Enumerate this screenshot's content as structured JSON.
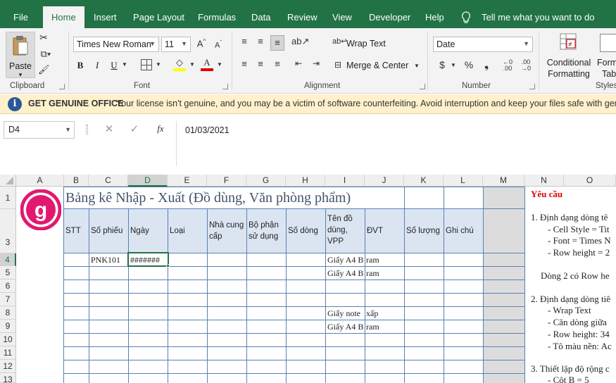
{
  "menu": {
    "tabs": [
      "File",
      "Home",
      "Insert",
      "Page Layout",
      "Formulas",
      "Data",
      "Review",
      "View",
      "Developer",
      "Help"
    ],
    "tell_me": "Tell me what you want to do"
  },
  "ribbon": {
    "paste_label": "Paste",
    "clipboard_label": "Clipboard",
    "font_name": "Times New Roman",
    "font_size": "11",
    "font_label": "Font",
    "bold": "B",
    "italic": "I",
    "underline": "U",
    "wrap_text": "Wrap Text",
    "merge_center": "Merge & Center",
    "alignment_label": "Alignment",
    "number_format": "Date",
    "number_label": "Number",
    "conditional_formatting_1": "Conditional",
    "conditional_formatting_2": "Formatting",
    "format_table_1": "Forma",
    "format_table_2": "Tab",
    "styles_label": "Styles",
    "font_color": "#e00000",
    "highlight_color": "#ffff00"
  },
  "banner": {
    "title": "GET GENUINE OFFICE",
    "message": "Your license isn't genuine, and you may be a victim of software counterfeiting. Avoid interruption and keep your files safe with genuine"
  },
  "formula_bar": {
    "name_box": "D4",
    "content": "01/03/2021"
  },
  "grid": {
    "columns": [
      "A",
      "B",
      "C",
      "D",
      "E",
      "F",
      "G",
      "H",
      "I",
      "J",
      "K",
      "L",
      "M",
      "N",
      "O"
    ],
    "rows": [
      "1",
      "3",
      "4",
      "5",
      "6",
      "7",
      "8",
      "9",
      "10",
      "11",
      "12",
      "13"
    ],
    "title": "Bảng kê Nhập - Xuất (Đồ dùng, Văn phòng phẩm)",
    "headers": {
      "stt": "STT",
      "so_phieu": "Số phiếu",
      "ngay": "Ngày",
      "loai": "Loại",
      "nha_cung_cap": "Nhà cung cấp",
      "bo_phan": "Bộ phận sử dụng",
      "so_dong": "Số dòng",
      "ten_do_dung": "Tên đồ dùng, VPP",
      "dvt": "ĐVT",
      "so_luong": "Số lượng",
      "ghi_chu": "Ghi chú"
    },
    "data": {
      "r4_c": "PNK101",
      "r4_d": "#######",
      "r4_i": "Giấy A4 B",
      "r4_j": "ram",
      "r5_i": "Giấy A4 B",
      "r5_j": "ram",
      "r8_i": "Giấy note",
      "r8_j": "xấp",
      "r9_i": "Giấy A4 B",
      "r9_j": "ram"
    },
    "logo_letter": "g",
    "logo_color": "#e2186f"
  },
  "notes": {
    "heading": "Yêu cầu",
    "l1": "1. Định dạng dòng tê",
    "l2": "- Cell Style = Tit",
    "l3": "- Font = Times N",
    "l4": "- Row height = 2",
    "l5": "Dòng 2 có Row he",
    "l6": "2. Định dạng dòng tiê",
    "l7": "- Wrap Text",
    "l8": "- Căn dòng giữa",
    "l9": "- Row height: 34",
    "l10": "- Tô màu nền: Ac",
    "l11": "3. Thiết lập độ rộng c",
    "l12": "- Cột B = 5"
  }
}
